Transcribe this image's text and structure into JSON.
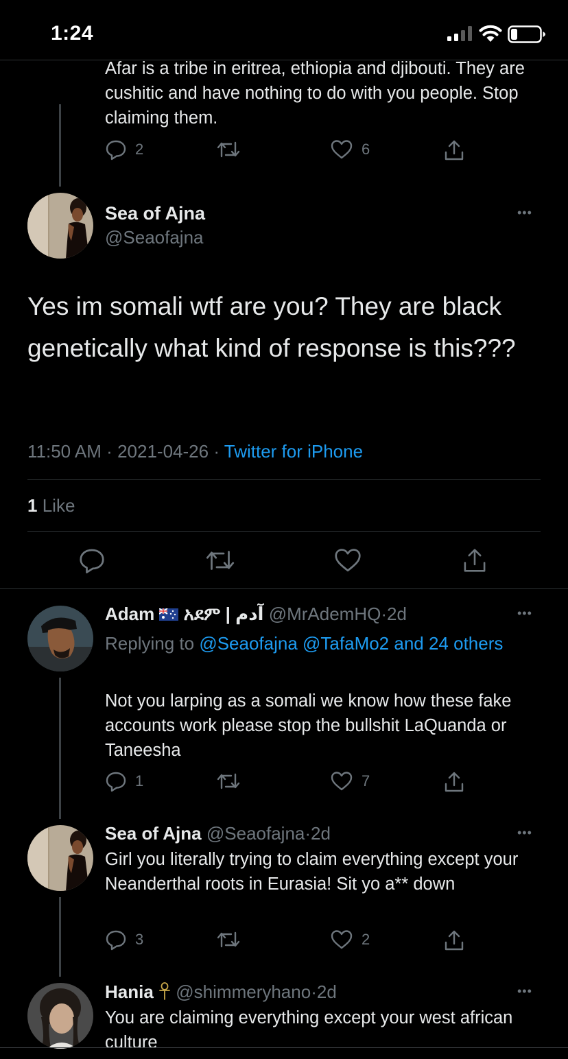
{
  "status_bar": {
    "time": "1:24"
  },
  "parent_tweet": {
    "text": "Afar is a tribe in eritrea, ethiopia and djibouti. They are cushitic and have nothing to do with you people. Stop claiming them.",
    "replies": "2",
    "likes": "6"
  },
  "main_tweet": {
    "name": "Sea of Ajna",
    "handle": "@Seaofajna",
    "text": "Yes im somali wtf are you? They are black genetically what kind of response is this???",
    "time": "11:50 AM",
    "date": "2021-04-26",
    "source": "Twitter for iPhone",
    "like_count": "1",
    "like_label": "Like"
  },
  "replies": [
    {
      "name": "Adam",
      "name_suffix": "አደም | آدم",
      "handle": "@MrAdemHQ",
      "age": "2d",
      "replying_to_label": "Replying to",
      "replying_to": "@Seaofajna @TafaMo2 and 24 others",
      "text": "Not you larping as a somali we know how these fake accounts work please stop the bullshit LaQuanda or Taneesha",
      "replies": "1",
      "likes": "7"
    },
    {
      "name": "Sea of Ajna",
      "handle": "@Seaofajna",
      "age": "2d",
      "text": "Girl you literally trying to claim everything except your Neanderthal roots in Eurasia! Sit yo a** down",
      "replies": "3",
      "likes": "2"
    },
    {
      "name": "Hania",
      "handle": "@shimmeryhano",
      "age": "2d",
      "text": "You are claiming everything except your west african culture"
    }
  ],
  "separators": {
    "dot": "·",
    "more": "•••"
  },
  "colors": {
    "background": "#000000",
    "link": "#1d9bf0",
    "muted": "#6e767d",
    "divider": "#2f3336"
  }
}
